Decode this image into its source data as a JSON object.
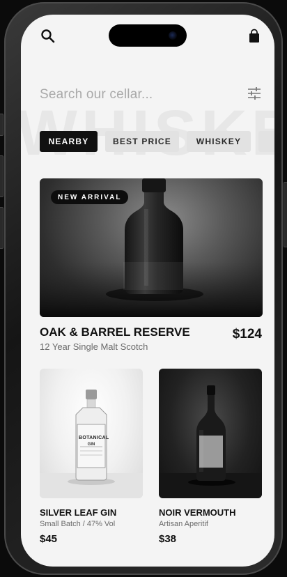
{
  "header": {
    "search_icon": "search-icon",
    "bag_icon": "shopping-bag-icon"
  },
  "background_word": "WHISKEY",
  "search": {
    "placeholder": "Search our cellar...",
    "filter_icon": "sliders-icon"
  },
  "chips": [
    {
      "label": "NEARBY",
      "active": true
    },
    {
      "label": "BEST PRICE",
      "active": false
    },
    {
      "label": "WHISKEY",
      "active": false
    }
  ],
  "featured": {
    "badge": "NEW ARRIVAL",
    "name": "OAK & BARREL RESERVE",
    "subtitle": "12 Year Single Malt Scotch",
    "price": "$124"
  },
  "products": [
    {
      "name": "SILVER LEAF GIN",
      "subtitle": "Small Batch / 47% Vol",
      "price": "$45",
      "label_text": "BOTANICAL",
      "label_sub": "GIN"
    },
    {
      "name": "NOIR VERMOUTH",
      "subtitle": "Artisan Aperitif",
      "price": "$38"
    }
  ],
  "colors": {
    "accent": "#111111",
    "chip_inactive": "#e2e2e2",
    "screen_bg": "#f4f4f4"
  }
}
